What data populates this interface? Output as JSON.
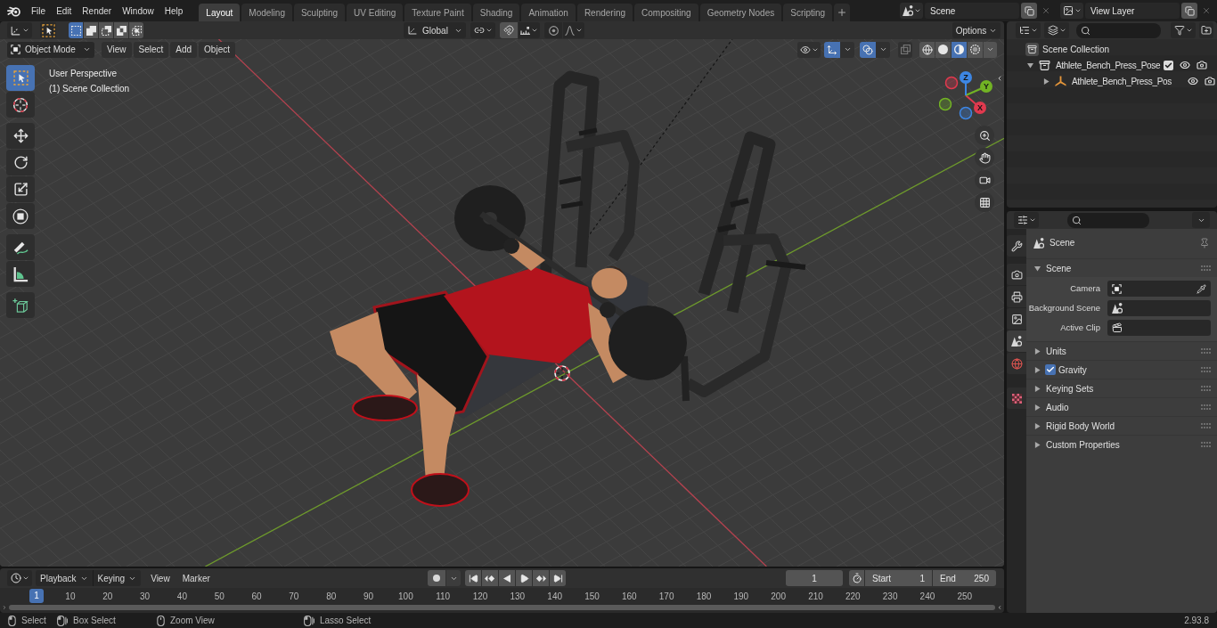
{
  "top_bar": {
    "menus": [
      "File",
      "Edit",
      "Render",
      "Window",
      "Help"
    ],
    "workspaces": [
      {
        "label": "Layout",
        "selected": true
      },
      {
        "label": "Modeling",
        "selected": false
      },
      {
        "label": "Sculpting",
        "selected": false
      },
      {
        "label": "UV Editing",
        "selected": false
      },
      {
        "label": "Texture Paint",
        "selected": false
      },
      {
        "label": "Shading",
        "selected": false
      },
      {
        "label": "Animation",
        "selected": false
      },
      {
        "label": "Rendering",
        "selected": false
      },
      {
        "label": "Compositing",
        "selected": false
      },
      {
        "label": "Geometry Nodes",
        "selected": false
      },
      {
        "label": "Scripting",
        "selected": false
      }
    ],
    "scene": "Scene",
    "view_layer": "View Layer"
  },
  "viewport": {
    "header": {
      "selection_modes": [
        {
          "kind": "set",
          "selected": true
        },
        {
          "kind": "extend",
          "selected": false
        },
        {
          "kind": "subtract",
          "selected": false
        },
        {
          "kind": "difference",
          "selected": false
        },
        {
          "kind": "intersect",
          "selected": false
        }
      ],
      "orientation": "Global",
      "options": "Options",
      "mode": "Object Mode",
      "menus": [
        "View",
        "Select",
        "Add",
        "Object"
      ],
      "gizmos_on": true,
      "overlays_on": true,
      "shading_modes": [
        {
          "kind": "wireframe",
          "selected": false
        },
        {
          "kind": "solid",
          "selected": false
        },
        {
          "kind": "material",
          "selected": true
        },
        {
          "kind": "rendered",
          "selected": false
        }
      ]
    },
    "tool_groups": [
      [
        {
          "kind": "select",
          "selected": true
        },
        {
          "kind": "cursor",
          "selected": false
        }
      ],
      [
        {
          "kind": "move",
          "selected": false
        },
        {
          "kind": "rotate",
          "selected": false
        },
        {
          "kind": "scale",
          "selected": false
        },
        {
          "kind": "transform",
          "selected": false
        }
      ],
      [
        {
          "kind": "annotate",
          "selected": false
        },
        {
          "kind": "measure",
          "selected": false
        }
      ],
      [
        {
          "kind": "add",
          "selected": false
        }
      ]
    ],
    "overlay_text": [
      "User Perspective",
      "(1) Scene Collection"
    ],
    "gizmo_axes": [
      {
        "label": "X",
        "color": "#e0394e"
      },
      {
        "label": "Y",
        "color": "#72b324"
      },
      {
        "label": "Z",
        "color": "#3d86e3"
      }
    ]
  },
  "outliner": {
    "root": {
      "label": "Scene Collection",
      "children": [
        {
          "label": "Athlete_Bench_Press_Pose",
          "kind": "collection",
          "expanded": true,
          "checked": true,
          "children": [
            {
              "label": "Athlete_Bench_Press_Pos",
              "kind": "armature",
              "expanded": false
            }
          ]
        }
      ]
    }
  },
  "properties": {
    "tabs": [
      [
        {
          "kind": "tool",
          "selected": false
        }
      ],
      [
        {
          "kind": "render",
          "selected": false
        },
        {
          "kind": "output",
          "selected": false
        },
        {
          "kind": "view_layer",
          "selected": false
        },
        {
          "kind": "scene",
          "selected": true
        },
        {
          "kind": "world",
          "selected": false
        }
      ],
      [
        {
          "kind": "texture",
          "selected": false
        }
      ]
    ],
    "context": "Scene",
    "panels": [
      {
        "label": "Scene",
        "expanded": true,
        "fields": [
          {
            "label": "Camera",
            "kind": "camera"
          },
          {
            "label": "Background Scene",
            "kind": "scene"
          },
          {
            "label": "Active Clip",
            "kind": "clip"
          }
        ]
      },
      {
        "label": "Units",
        "expanded": false
      },
      {
        "label": "Gravity",
        "expanded": false,
        "toggle": {
          "checked": true
        }
      },
      {
        "label": "Keying Sets",
        "expanded": false
      },
      {
        "label": "Audio",
        "expanded": false
      },
      {
        "label": "Rigid Body World",
        "expanded": false
      },
      {
        "label": "Custom Properties",
        "expanded": false
      }
    ]
  },
  "timeline": {
    "dropdowns": [
      "Playback",
      "Keying"
    ],
    "menus": [
      "View",
      "Marker"
    ],
    "current_frame": "1",
    "start": {
      "label": "Start",
      "value": "1"
    },
    "end": {
      "label": "End",
      "value": "250"
    },
    "ruler": [
      {
        "label": "1",
        "selected": true
      },
      {
        "label": "10",
        "selected": false
      },
      {
        "label": "20",
        "selected": false
      },
      {
        "label": "30",
        "selected": false
      },
      {
        "label": "40",
        "selected": false
      },
      {
        "label": "50",
        "selected": false
      },
      {
        "label": "60",
        "selected": false
      },
      {
        "label": "70",
        "selected": false
      },
      {
        "label": "80",
        "selected": false
      },
      {
        "label": "90",
        "selected": false
      },
      {
        "label": "100",
        "selected": false
      },
      {
        "label": "110",
        "selected": false
      },
      {
        "label": "120",
        "selected": false
      },
      {
        "label": "130",
        "selected": false
      },
      {
        "label": "140",
        "selected": false
      },
      {
        "label": "150",
        "selected": false
      },
      {
        "label": "160",
        "selected": false
      },
      {
        "label": "170",
        "selected": false
      },
      {
        "label": "180",
        "selected": false
      },
      {
        "label": "190",
        "selected": false
      },
      {
        "label": "200",
        "selected": false
      },
      {
        "label": "210",
        "selected": false
      },
      {
        "label": "220",
        "selected": false
      },
      {
        "label": "230",
        "selected": false
      },
      {
        "label": "240",
        "selected": false
      },
      {
        "label": "250",
        "selected": false
      }
    ]
  },
  "status_bar": {
    "hints": [
      {
        "label": "Select",
        "kind": "left"
      },
      {
        "label": "Box Select",
        "kind": "drag"
      },
      {
        "label": "Zoom View",
        "kind": "middle"
      },
      {
        "label": "Lasso Select",
        "kind": "drag"
      }
    ],
    "version": "2.93.8"
  }
}
